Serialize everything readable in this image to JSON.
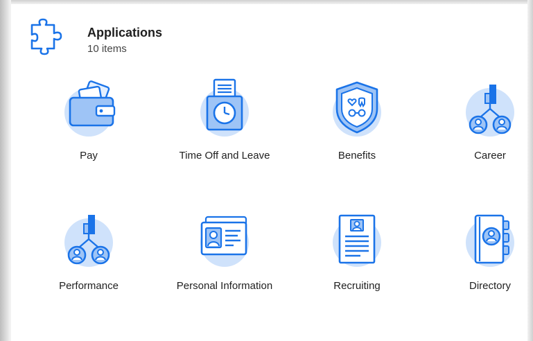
{
  "header": {
    "title": "Applications",
    "subtitle": "10 items",
    "icon": "puzzle-icon"
  },
  "apps": [
    {
      "label": "Pay",
      "icon": "wallet-icon"
    },
    {
      "label": "Time Off and Leave",
      "icon": "calendar-clock-icon"
    },
    {
      "label": "Benefits",
      "icon": "shield-icon"
    },
    {
      "label": "Career",
      "icon": "career-people-chart-icon"
    },
    {
      "label": "Performance",
      "icon": "performance-people-chart-icon"
    },
    {
      "label": "Personal Information",
      "icon": "id-card-icon"
    },
    {
      "label": "Recruiting",
      "icon": "resume-icon"
    },
    {
      "label": "Directory",
      "icon": "address-book-icon"
    }
  ],
  "colors": {
    "accent": "#1a73e8",
    "accent_light": "#cfe2fb",
    "icon_fill": "#e3efff"
  }
}
